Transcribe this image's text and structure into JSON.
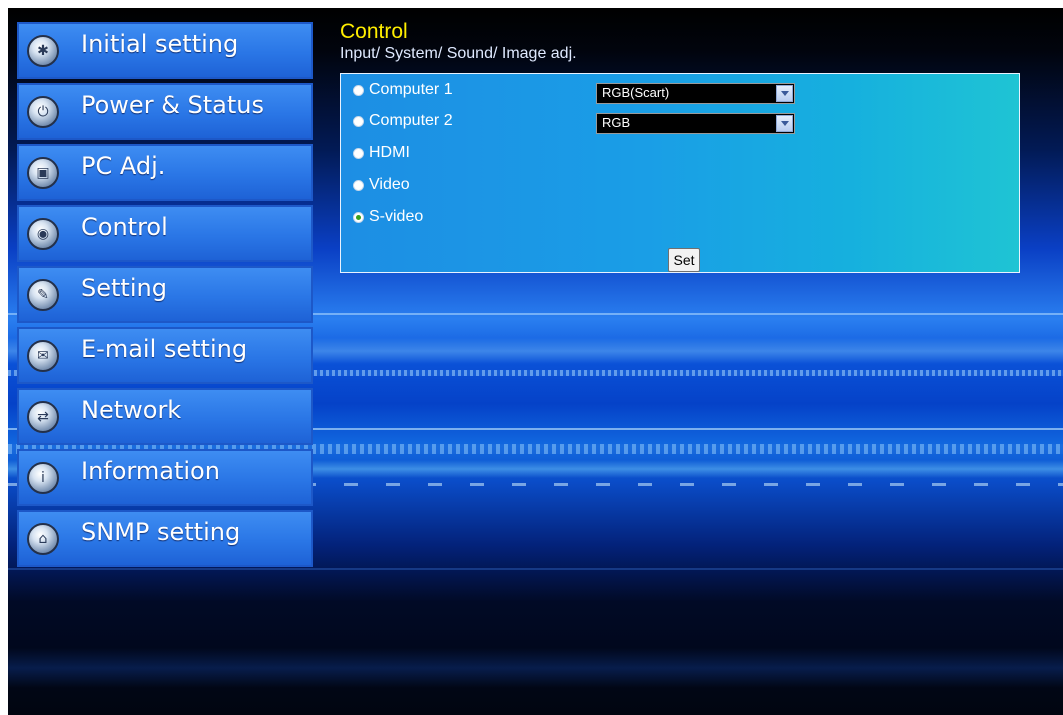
{
  "sidebar": {
    "items": [
      {
        "label": "Initial setting",
        "icon": "gear-icon",
        "glyph": "✱"
      },
      {
        "label": "Power & Status",
        "icon": "power-icon",
        "glyph": "⏻"
      },
      {
        "label": "PC Adj.",
        "icon": "monitor-icon",
        "glyph": "▣"
      },
      {
        "label": "Control",
        "icon": "control-icon",
        "glyph": "◉"
      },
      {
        "label": "Setting",
        "icon": "wrench-icon",
        "glyph": "✎"
      },
      {
        "label": "E-mail setting",
        "icon": "mail-icon",
        "glyph": "✉"
      },
      {
        "label": "Network",
        "icon": "network-icon",
        "glyph": "⇄"
      },
      {
        "label": "Information",
        "icon": "info-icon",
        "glyph": "i"
      },
      {
        "label": "SNMP setting",
        "icon": "snmp-icon",
        "glyph": "⌂"
      }
    ]
  },
  "main": {
    "title": "Control",
    "subtitle": "Input/ System/ Sound/ Image adj.",
    "inputs": [
      {
        "label": "Computer 1",
        "checked": false,
        "select_value": "RGB(Scart)"
      },
      {
        "label": "Computer 2",
        "checked": false,
        "select_value": "RGB"
      },
      {
        "label": "HDMI",
        "checked": false
      },
      {
        "label": "Video",
        "checked": false
      },
      {
        "label": "S-video",
        "checked": true
      }
    ],
    "set_label": "Set"
  },
  "colors": {
    "title": "#ffee00",
    "nav_item": "#2a76e6",
    "panel": "#1a9ee6",
    "radio_checked": "#3aa01c"
  }
}
